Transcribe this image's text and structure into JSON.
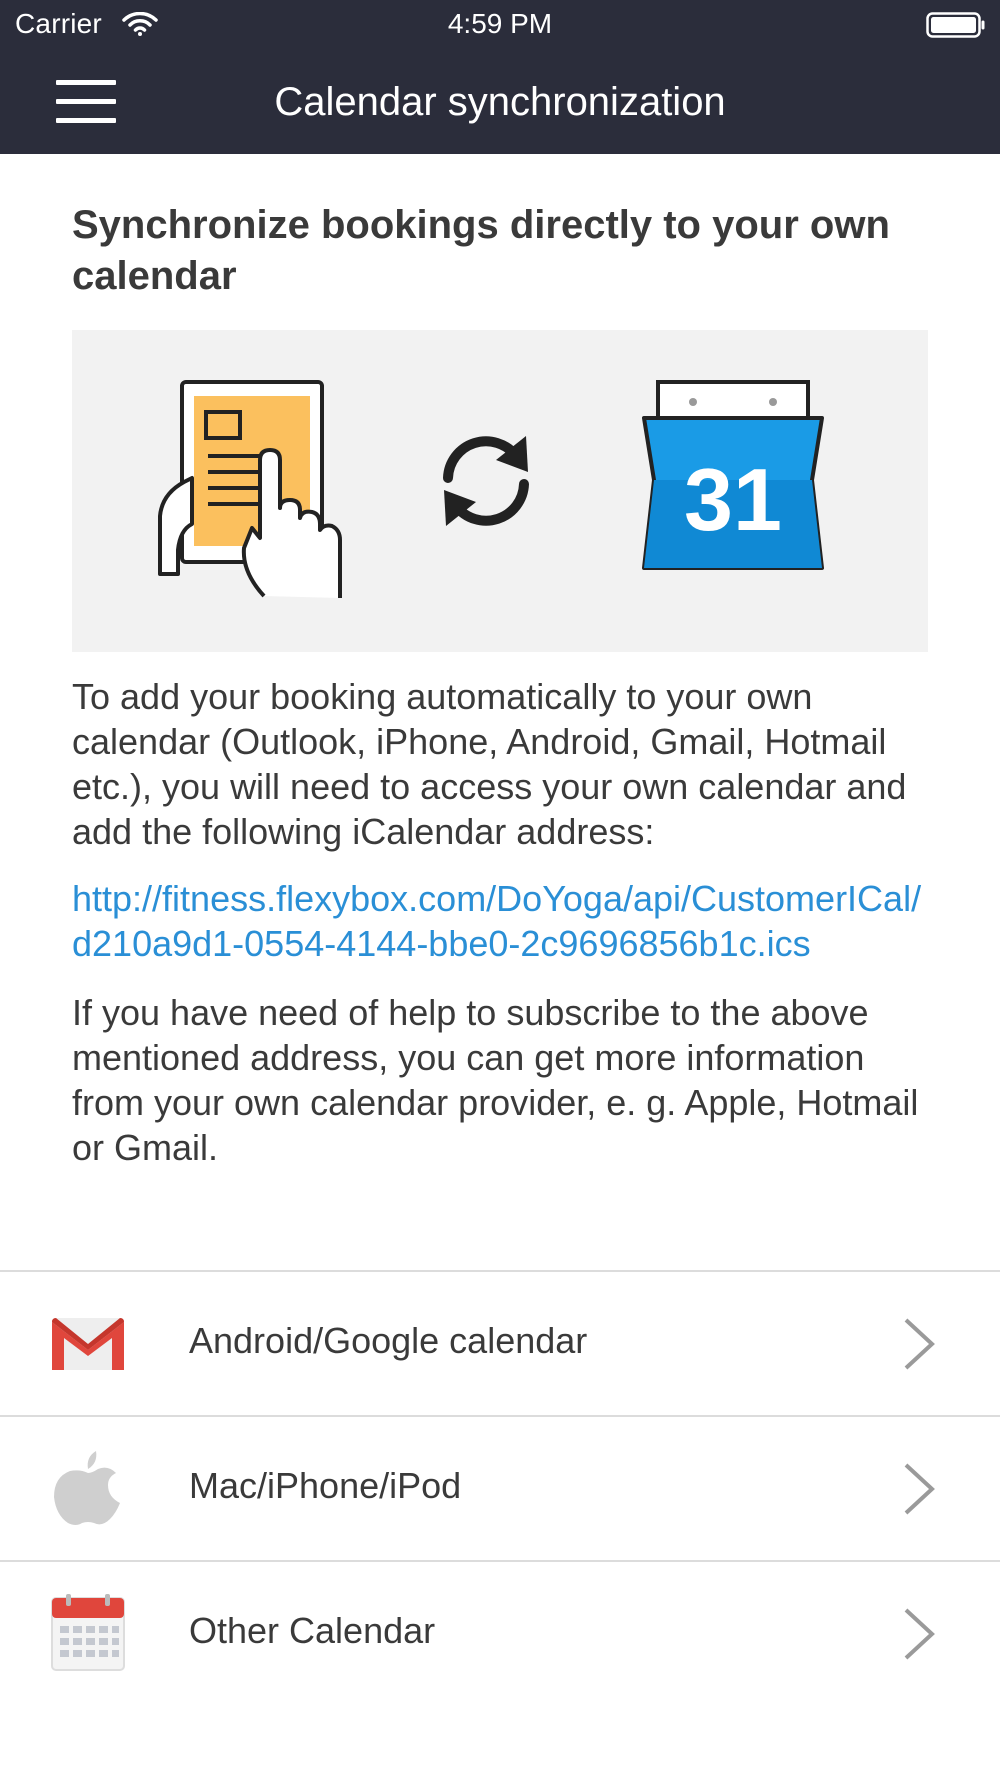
{
  "status_bar": {
    "carrier": "Carrier",
    "time": "4:59 PM",
    "wifi_icon": "wifi-icon",
    "battery_icon": "battery-icon"
  },
  "nav": {
    "menu_icon": "hamburger-menu-icon",
    "title": "Calendar synchronization"
  },
  "main": {
    "heading": "Synchronize bookings directly to your own calendar",
    "illustration_icons": [
      "tablet-touch-icon",
      "sync-icon",
      "calendar-31-icon"
    ],
    "calendar_day": "31",
    "intro_text": "To add your booking automatically to your own calendar (Outlook, iPhone, Android, Gmail, Hotmail etc.), you will need to access your own calendar and add the following iCalendar address:",
    "ical_link": "http://fitness.flexybox.com/DoYoga/api/CustomerICal/d210a9d1-0554-4144-bbe0-2c9696856b1c.ics",
    "help_text": "If you have need of help to subscribe to the above mentioned address, you can get more information from your own calendar provider, e. g. Apple, Hotmail or Gmail."
  },
  "calendar_options": [
    {
      "label": "Android/Google calendar",
      "icon": "gmail-icon"
    },
    {
      "label": "Mac/iPhone/iPod",
      "icon": "apple-icon"
    },
    {
      "label": "Other Calendar",
      "icon": "calendar-icon"
    }
  ],
  "colors": {
    "nav_background": "#2b2d3b",
    "link": "#2a8fd6",
    "divider": "#dcdcdc",
    "illustration_background": "#f2f2f2",
    "calendar_blue": "#1a9be6",
    "tablet_orange": "#fbc05e"
  }
}
